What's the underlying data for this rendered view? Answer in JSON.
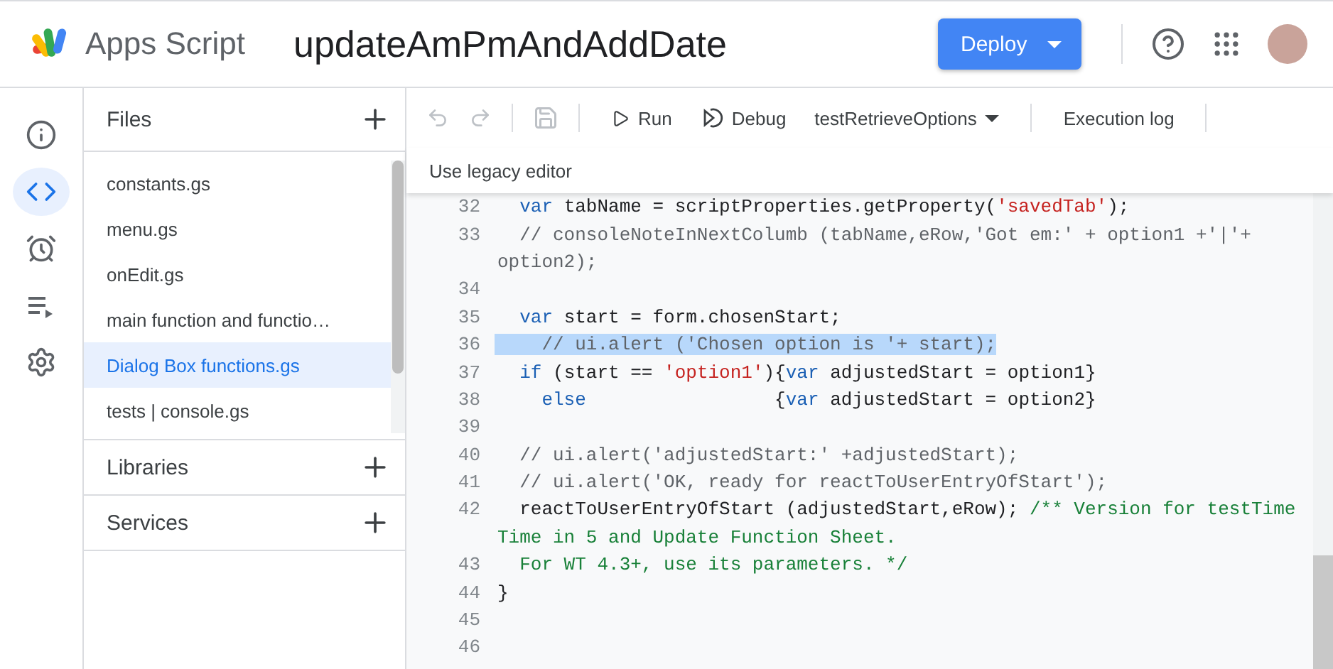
{
  "header": {
    "product": "Apps Script",
    "project_title": "updateAmPmAndAddDate",
    "deploy_button": "Deploy"
  },
  "rail": [
    {
      "selected": false
    },
    {
      "selected": true
    },
    {
      "selected": false
    },
    {
      "selected": false
    },
    {
      "selected": false
    }
  ],
  "files_panel": {
    "title": "Files",
    "files": [
      {
        "name": "constants.gs",
        "selected": false
      },
      {
        "name": "menu.gs",
        "selected": false
      },
      {
        "name": "onEdit.gs",
        "selected": false
      },
      {
        "name": "main function and functio…",
        "selected": false
      },
      {
        "name": "Dialog Box functions.gs",
        "selected": true
      },
      {
        "name": "tests | console.gs",
        "selected": false
      }
    ],
    "sections": [
      "Libraries",
      "Services"
    ]
  },
  "toolbar": {
    "run": "Run",
    "debug": "Debug",
    "function": "testRetrieveOptions",
    "execution_log": "Execution log",
    "legacy": "Use legacy editor"
  },
  "code_rows": [
    {
      "number": "32",
      "highlighted": false,
      "parts": [
        {
          "kind": "keyword",
          "text": "  var"
        },
        {
          "kind": "plain",
          "text": " tabName = scriptProperties.getProperty("
        },
        {
          "kind": "string",
          "text": "'savedTab'"
        },
        {
          "kind": "plain",
          "text": ");"
        }
      ]
    },
    {
      "number": "33",
      "highlighted": false,
      "parts": [
        {
          "kind": "comment",
          "text": "  // consoleNoteInNextColumb (tabName,eRow,'Got em:' + option1 +'|'+"
        }
      ]
    },
    {
      "highlighted": false,
      "parts": [
        {
          "kind": "comment",
          "text": "option2);"
        }
      ]
    },
    {
      "number": "34",
      "highlighted": false,
      "parts": []
    },
    {
      "number": "35",
      "highlighted": false,
      "parts": [
        {
          "kind": "keyword",
          "text": "  var"
        },
        {
          "kind": "plain",
          "text": " start = form.chosenStart;"
        }
      ]
    },
    {
      "number": "36",
      "highlighted": true,
      "parts": [
        {
          "kind": "comment",
          "text": "    // ui.alert ('Chosen option is '+ start);"
        }
      ]
    },
    {
      "number": "37",
      "highlighted": false,
      "parts": [
        {
          "kind": "keyword",
          "text": "  if"
        },
        {
          "kind": "plain",
          "text": " (start == "
        },
        {
          "kind": "string",
          "text": "'option1'"
        },
        {
          "kind": "plain",
          "text": "){"
        },
        {
          "kind": "keyword",
          "text": "var"
        },
        {
          "kind": "plain",
          "text": " adjustedStart = option1}"
        }
      ]
    },
    {
      "number": "38",
      "highlighted": false,
      "parts": [
        {
          "kind": "keyword",
          "text": "    else"
        },
        {
          "kind": "plain",
          "text": "                 {"
        },
        {
          "kind": "keyword",
          "text": "var"
        },
        {
          "kind": "plain",
          "text": " adjustedStart = option2}"
        }
      ]
    },
    {
      "number": "39",
      "highlighted": false,
      "parts": []
    },
    {
      "number": "40",
      "highlighted": false,
      "parts": [
        {
          "kind": "comment",
          "text": "  // ui.alert('adjustedStart:' +adjustedStart);"
        }
      ]
    },
    {
      "number": "41",
      "highlighted": false,
      "parts": [
        {
          "kind": "comment",
          "text": "  // ui.alert('OK, ready for reactToUserEntryOfStart');"
        }
      ]
    },
    {
      "number": "42",
      "highlighted": false,
      "parts": [
        {
          "kind": "plain",
          "text": "  reactToUserEntryOfStart (adjustedStart,eRow); "
        },
        {
          "kind": "doc",
          "text": "/** Version for testTime"
        }
      ]
    },
    {
      "highlighted": false,
      "parts": [
        {
          "kind": "doc",
          "text": "Time in 5 and Update Function Sheet."
        }
      ]
    },
    {
      "number": "43",
      "highlighted": false,
      "parts": [
        {
          "kind": "doc",
          "text": "  For WT 4.3+, use its parameters. */"
        }
      ]
    },
    {
      "number": "44",
      "highlighted": false,
      "parts": [
        {
          "kind": "plain",
          "text": "}"
        }
      ]
    },
    {
      "number": "45",
      "highlighted": false,
      "parts": []
    },
    {
      "number": "46",
      "highlighted": false,
      "parts": []
    }
  ]
}
